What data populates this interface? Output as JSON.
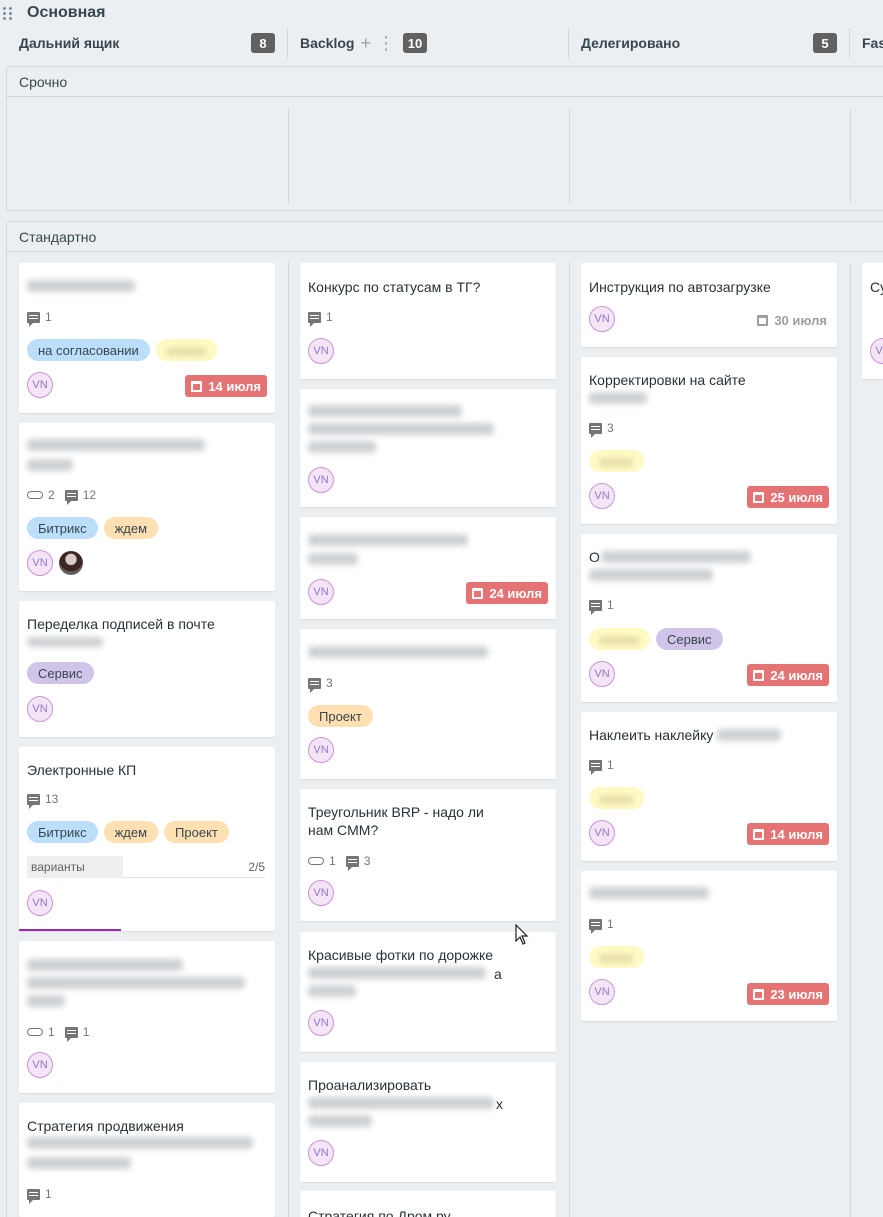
{
  "board": {
    "title": "Основная"
  },
  "columns": [
    {
      "name": "Дальний ящик",
      "count": "8"
    },
    {
      "name": "Backlog",
      "count": "10",
      "add_icon": "plus-icon",
      "more_icon": "kebab-icon"
    },
    {
      "name": "Делегировано",
      "count": "5"
    },
    {
      "name": "Fas"
    }
  ],
  "lanes": {
    "urgent": "Срочно",
    "standard": "Стандартно"
  },
  "avatar_initials": "VN",
  "cards": {
    "c1": {
      "comments": "1",
      "tags": [
        "на согласовании"
      ],
      "due": "14 июля"
    },
    "c2": {
      "attachments": "2",
      "comments": "12",
      "tags": [
        "Битрикс",
        "ждем"
      ]
    },
    "c3": {
      "title": "Переделка подписей в почте",
      "tags": [
        "Сервис"
      ]
    },
    "c4": {
      "title": "Электронные КП",
      "comments": "13",
      "tags": [
        "Битрикс",
        "ждем",
        "Проект"
      ],
      "checklist": {
        "name": "варианты",
        "count": "2/5",
        "progress": 0.4
      }
    },
    "c5": {
      "attachments": "1",
      "comments": "1"
    },
    "c6": {
      "title": "Стратегия продвижения",
      "comments": "1"
    },
    "b1": {
      "title": "Конкурс по статусам в ТГ?",
      "comments": "1"
    },
    "b3": {
      "due": "24 июля"
    },
    "b4": {
      "comments": "3",
      "tags": [
        "Проект"
      ]
    },
    "b5": {
      "title_line1": "Треугольник BRP - надо ли",
      "title_line2": "нам CMM?",
      "attachments": "1",
      "comments": "3"
    },
    "b6": {
      "title": "Красивые фотки по дорожке",
      "title_suffix": "а"
    },
    "b7": {
      "title": "Проанализировать",
      "title_suffix": "х"
    },
    "b8": {
      "title": "Стратегия по Дром.ру"
    },
    "d1": {
      "title": "Инструкция по автозагрузке",
      "due": "30 июля"
    },
    "d2": {
      "title": "Корректировки на сайте",
      "comments": "3",
      "due": "25 июля"
    },
    "d3": {
      "title_prefix": "О",
      "comments": "1",
      "tags": [
        "Сервис"
      ],
      "due": "24 июля"
    },
    "d4": {
      "title": "Наклеить наклейку",
      "comments": "1",
      "due": "14 июля"
    },
    "d5": {
      "comments": "1",
      "due": "23 июля"
    },
    "f1": {
      "title": "Су"
    }
  }
}
